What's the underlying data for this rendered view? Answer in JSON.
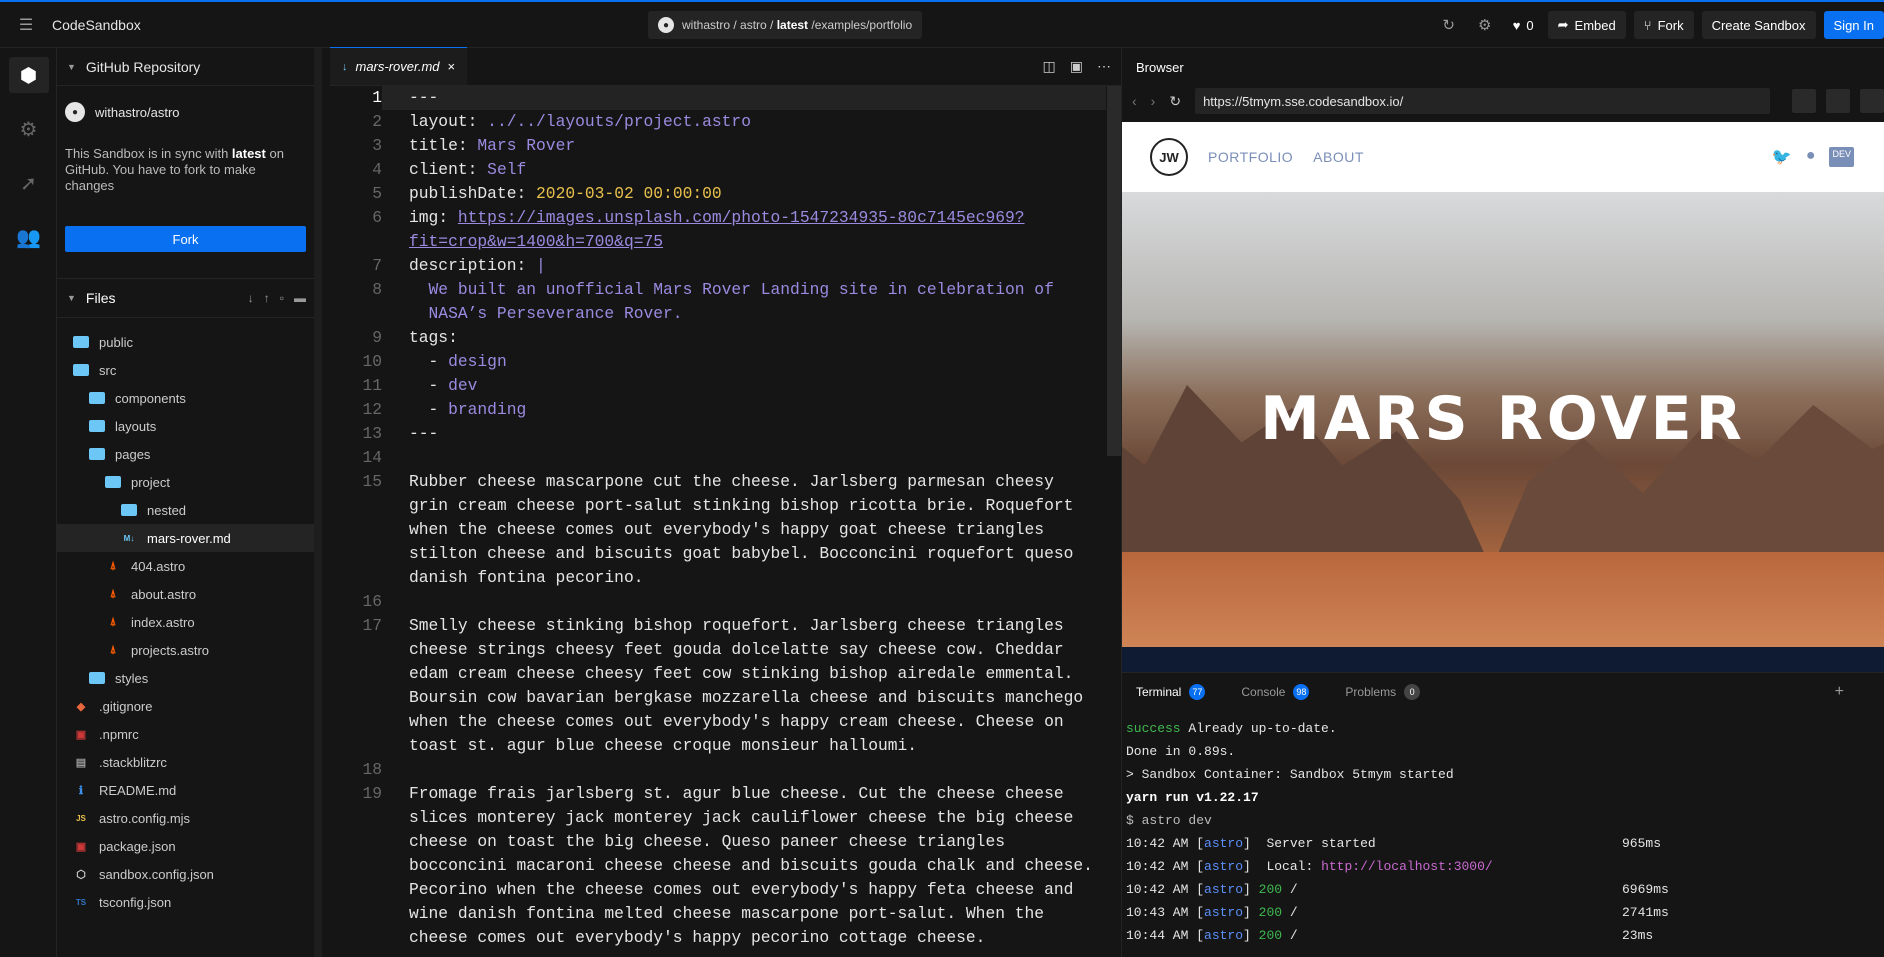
{
  "topbar": {
    "brand": "CodeSandbox",
    "repo_prefix": "withastro / astro / ",
    "repo_branch": "latest",
    "repo_path": " /examples/portfolio",
    "likes": "0",
    "embed": "Embed",
    "fork": "Fork",
    "create": "Create Sandbox",
    "signin": "Sign In"
  },
  "sidebar": {
    "repo_title": "GitHub Repository",
    "repo_name": "withastro/astro",
    "sync_pre": "This Sandbox is in sync with ",
    "sync_bold": "latest",
    "sync_post": " on GitHub. You have to fork to make changes",
    "fork_label": "Fork",
    "files_title": "Files",
    "tree": [
      {
        "name": "public",
        "type": "folder"
      },
      {
        "name": "src",
        "type": "folder"
      },
      {
        "name": "components",
        "type": "folder"
      },
      {
        "name": "layouts",
        "type": "folder"
      },
      {
        "name": "pages",
        "type": "folder"
      },
      {
        "name": "project",
        "type": "folder"
      },
      {
        "name": "nested",
        "type": "folder"
      },
      {
        "name": "mars-rover.md",
        "type": "md"
      },
      {
        "name": "404.astro",
        "type": "astro"
      },
      {
        "name": "about.astro",
        "type": "astro"
      },
      {
        "name": "index.astro",
        "type": "astro"
      },
      {
        "name": "projects.astro",
        "type": "astro"
      },
      {
        "name": "styles",
        "type": "folder"
      },
      {
        "name": ".gitignore",
        "type": "git"
      },
      {
        "name": ".npmrc",
        "type": "npm"
      },
      {
        "name": ".stackblitzrc",
        "type": "file"
      },
      {
        "name": "README.md",
        "type": "info"
      },
      {
        "name": "astro.config.mjs",
        "type": "js"
      },
      {
        "name": "package.json",
        "type": "npm"
      },
      {
        "name": "sandbox.config.json",
        "type": "box"
      },
      {
        "name": "tsconfig.json",
        "type": "ts"
      }
    ]
  },
  "editor": {
    "tab_name": "mars-rover.md",
    "line_numbers": [
      "1",
      "2",
      "3",
      "4",
      "5",
      "6",
      "7",
      "8",
      "9",
      "10",
      "11",
      "12",
      "13",
      "14",
      "15",
      "16",
      "17",
      "18",
      "19"
    ],
    "frontmatter": {
      "dashes": "---",
      "layout_key": "layout",
      "layout_val": "../../layouts/project.astro",
      "title_key": "title",
      "title_val": "Mars Rover",
      "client_key": "client",
      "client_val": "Self",
      "date_key": "publishDate",
      "date_val": "2020-03-02 00:00:00",
      "img_key": "img",
      "img_val_1": "https://images.unsplash.com/photo-1547234935-80c7145ec969?",
      "img_val_2": "fit=crop&w=1400&h=700&q=75",
      "desc_key": "description",
      "desc_val": "|",
      "desc_1": "  We built an unofficial Mars Rover Landing site in celebration of",
      "desc_2": "  NASA’s Perseverance Rover.",
      "tags_key": "tags",
      "tag_dash": "  - ",
      "tags": [
        "design",
        "dev",
        "branding"
      ]
    },
    "para1": [
      "Rubber cheese mascarpone cut the cheese. Jarlsberg parmesan cheesy",
      "grin cream cheese port-salut stinking bishop ricotta brie. Roquefort",
      "when the cheese comes out everybody's happy goat cheese triangles",
      "stilton cheese and biscuits goat babybel. Bocconcini roquefort queso",
      "danish fontina pecorino."
    ],
    "para2": [
      "Smelly cheese stinking bishop roquefort. Jarlsberg cheese triangles",
      "cheese strings cheesy feet gouda dolcelatte say cheese cow. Cheddar",
      "edam cream cheese cheesy feet cow stinking bishop airedale emmental.",
      "Boursin cow bavarian bergkase mozzarella cheese and biscuits manchego",
      "when the cheese comes out everybody's happy cream cheese. Cheese on",
      "toast st. agur blue cheese croque monsieur halloumi."
    ],
    "para3": [
      "Fromage frais jarlsberg st. agur blue cheese. Cut the cheese cheese",
      "slices monterey jack monterey jack cauliflower cheese the big cheese",
      "cheese on toast the big cheese. Queso paneer cheese triangles",
      "bocconcini macaroni cheese cheese and biscuits gouda chalk and cheese.",
      "Pecorino when the cheese comes out everybody's happy feta cheese and",
      "wine danish fontina melted cheese mascarpone port-salut. When the",
      "cheese comes out everybody's happy pecorino cottage cheese."
    ]
  },
  "browser": {
    "title": "Browser",
    "url": "https://5tmym.sse.codesandbox.io/",
    "logo": "JW",
    "nav": [
      "PORTFOLIO",
      "ABOUT"
    ],
    "social_dev": "DEV",
    "hero_title": "MARS ROVER"
  },
  "terminal": {
    "tabs": [
      {
        "label": "Terminal",
        "count": "77"
      },
      {
        "label": "Console",
        "count": "98"
      },
      {
        "label": "Problems",
        "count": "0"
      }
    ],
    "success_word": "success",
    "success_rest": " Already up-to-date.",
    "done": "Done in 0.89s.",
    "container": "> Sandbox Container: Sandbox 5tmym started",
    "yarn": "yarn run v1.22.17",
    "cmd": "$ astro dev",
    "logs": [
      {
        "time": "10:42 AM",
        "tag": "astro",
        "code": "",
        "msg": " Server started",
        "ms": "965ms"
      },
      {
        "time": "10:42 AM",
        "tag": "astro",
        "code": "",
        "msg": " Local: ",
        "link": "http://localhost:3000/",
        "ms": ""
      },
      {
        "time": "10:42 AM",
        "tag": "astro",
        "code": "200",
        "msg": " /",
        "ms": "6969ms"
      },
      {
        "time": "10:43 AM",
        "tag": "astro",
        "code": "200",
        "msg": " /",
        "ms": "2741ms"
      },
      {
        "time": "10:44 AM",
        "tag": "astro",
        "code": "200",
        "msg": " /",
        "ms": "23ms"
      }
    ]
  }
}
